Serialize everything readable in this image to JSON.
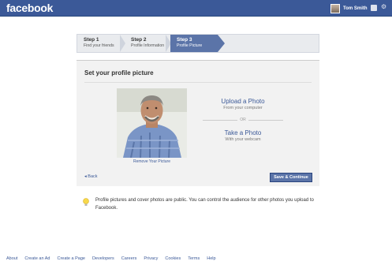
{
  "app": {
    "logo": "facebook"
  },
  "topbar": {
    "user_name": "Tom Smith",
    "icons": [
      "friend-requests-icon",
      "settings-gear-icon"
    ]
  },
  "steps": [
    {
      "title": "Step 1",
      "subtitle": "Find your friends",
      "active": false
    },
    {
      "title": "Step 2",
      "subtitle": "Profile Information",
      "active": false
    },
    {
      "title": "Step 3",
      "subtitle": "Profile Picture",
      "active": true
    }
  ],
  "panel": {
    "heading": "Set your profile picture",
    "remove_link": "Remove Your Picture",
    "upload": {
      "title": "Upload a Photo",
      "subtitle": "From your computer"
    },
    "or_label": "OR",
    "take": {
      "title": "Take a Photo",
      "subtitle": "With your webcam"
    },
    "back_link": "◂ Back",
    "save_button": "Save & Continue"
  },
  "note": {
    "text": "Profile pictures and cover photos are public. You can control the audience for other photos you upload to Facebook."
  },
  "footer": {
    "links": [
      "About",
      "Create an Ad",
      "Create a Page",
      "Developers",
      "Careers",
      "Privacy",
      "Cookies",
      "Terms",
      "Help"
    ]
  },
  "colors": {
    "brand": "#3b5998",
    "active_step": "#5b74a8",
    "panel_bg": "#f2f2f2"
  }
}
